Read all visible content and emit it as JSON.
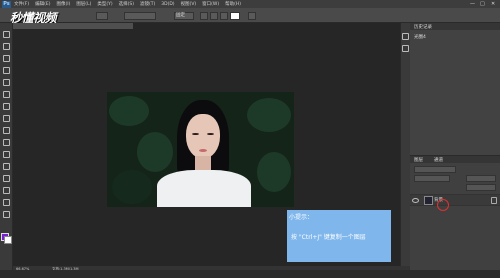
{
  "app": {
    "logo": "Ps",
    "watermark": "秒懂视频"
  },
  "menu": [
    "文件(F)",
    "编辑(E)",
    "图像(I)",
    "图层(L)",
    "类型(Y)",
    "选择(S)",
    "滤镜(T)",
    "3D(D)",
    "视图(V)",
    "窗口(W)",
    "帮助(H)"
  ],
  "window_controls": {
    "minimize": "—",
    "restore": "□",
    "close": "✕"
  },
  "options_bar": {
    "mode_label": "固定"
  },
  "panels": {
    "history_tab": "历史记录",
    "history_item": "光圈4",
    "layers_tab": "图层",
    "channels_tab": "通道"
  },
  "layers": [
    {
      "name": "背景"
    }
  ],
  "tip": {
    "title": "小提示：",
    "text": "按 \"Ctrl+J\" 键复制一个图层"
  },
  "status": {
    "zoom": "66.67%",
    "doc": "文档:1.3M/1.3M"
  },
  "colors": {
    "accent_tip": "#7fb6ec",
    "foreground": "#7a1fd0",
    "background": "#ffffff",
    "cursor_ring": "#e03030"
  },
  "icons": [
    "move-icon",
    "marquee-icon",
    "lasso-icon",
    "magic-wand-icon",
    "crop-icon",
    "eyedropper-icon",
    "brush-icon",
    "eraser-icon",
    "gradient-icon",
    "text-icon",
    "hand-icon",
    "zoom-icon",
    "eye-icon",
    "lock-icon"
  ]
}
